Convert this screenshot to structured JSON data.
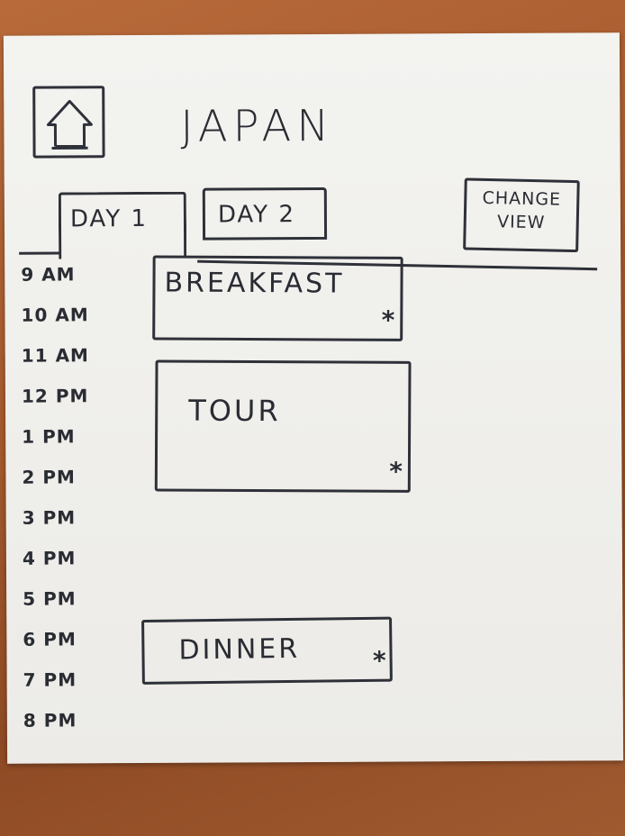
{
  "header": {
    "home_icon": "home-arrow-icon",
    "title": "JAPAN"
  },
  "tabs": [
    {
      "label": "DAY 1",
      "selected": true
    },
    {
      "label": "DAY 2",
      "selected": false
    }
  ],
  "change_view": {
    "label": "CHANGE VIEW"
  },
  "timeline": {
    "times": [
      "9 AM",
      "10 AM",
      "11 AM",
      "12 PM",
      "1 PM",
      "2 PM",
      "3 PM",
      "4 PM",
      "5 PM",
      "6 PM",
      "7 PM",
      "8 PM"
    ]
  },
  "events": [
    {
      "label": "BREAKFAST",
      "marker": "*"
    },
    {
      "label": "TOUR",
      "marker": "*"
    },
    {
      "label": "DINNER",
      "marker": "*"
    }
  ],
  "colors": {
    "ink": "#2f3139",
    "paper": "#f1f1ee",
    "table": "#a55a2e"
  }
}
